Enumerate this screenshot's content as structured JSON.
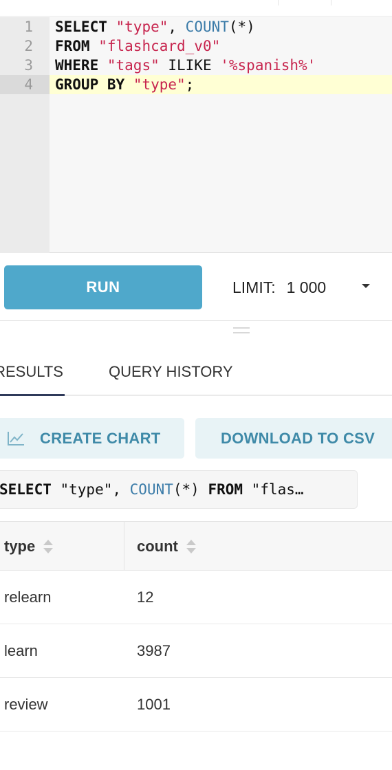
{
  "editor": {
    "lines": [
      {
        "num": "1",
        "tokens": [
          {
            "t": "SELECT",
            "k": "kw"
          },
          {
            "t": " ",
            "k": "op"
          },
          {
            "t": "\"type\"",
            "k": "str"
          },
          {
            "t": ", ",
            "k": "op"
          },
          {
            "t": "COUNT",
            "k": "fn"
          },
          {
            "t": "(*)",
            "k": "op"
          }
        ]
      },
      {
        "num": "2",
        "tokens": [
          {
            "t": "FROM",
            "k": "kw"
          },
          {
            "t": " ",
            "k": "op"
          },
          {
            "t": "\"flashcard_v0\"",
            "k": "str"
          }
        ]
      },
      {
        "num": "3",
        "tokens": [
          {
            "t": "WHERE",
            "k": "kw"
          },
          {
            "t": " ",
            "k": "op"
          },
          {
            "t": "\"tags\"",
            "k": "str"
          },
          {
            "t": " ILIKE ",
            "k": "op"
          },
          {
            "t": "'%spanish%'",
            "k": "str"
          }
        ]
      },
      {
        "num": "4",
        "tokens": [
          {
            "t": "GROUP BY",
            "k": "kw"
          },
          {
            "t": " ",
            "k": "op"
          },
          {
            "t": "\"type\"",
            "k": "str"
          },
          {
            "t": ";",
            "k": "op"
          }
        ]
      }
    ]
  },
  "toolbar": {
    "run_label": "RUN",
    "limit_label": "LIMIT:",
    "limit_value": "1 000"
  },
  "tabs": {
    "results": "RESULTS",
    "history": "QUERY HISTORY"
  },
  "actions": {
    "create_chart": "CREATE CHART",
    "download_csv": "DOWNLOAD TO CSV"
  },
  "query_pill": {
    "tokens": [
      {
        "t": "SELECT",
        "k": "kw"
      },
      {
        "t": " \"type\", ",
        "k": "op"
      },
      {
        "t": "COUNT",
        "k": "fn"
      },
      {
        "t": "(*) ",
        "k": "op"
      },
      {
        "t": "FROM",
        "k": "kw"
      },
      {
        "t": " \"flas…",
        "k": "op"
      }
    ]
  },
  "table": {
    "columns": [
      "type",
      "count"
    ],
    "rows": [
      [
        "relearn",
        "12"
      ],
      [
        "learn",
        "3987"
      ],
      [
        "review",
        "1001"
      ]
    ]
  },
  "colors": {
    "run_button": "#4fa8cb",
    "action_text": "#3f8aa8",
    "active_line": "#ffffd4"
  }
}
